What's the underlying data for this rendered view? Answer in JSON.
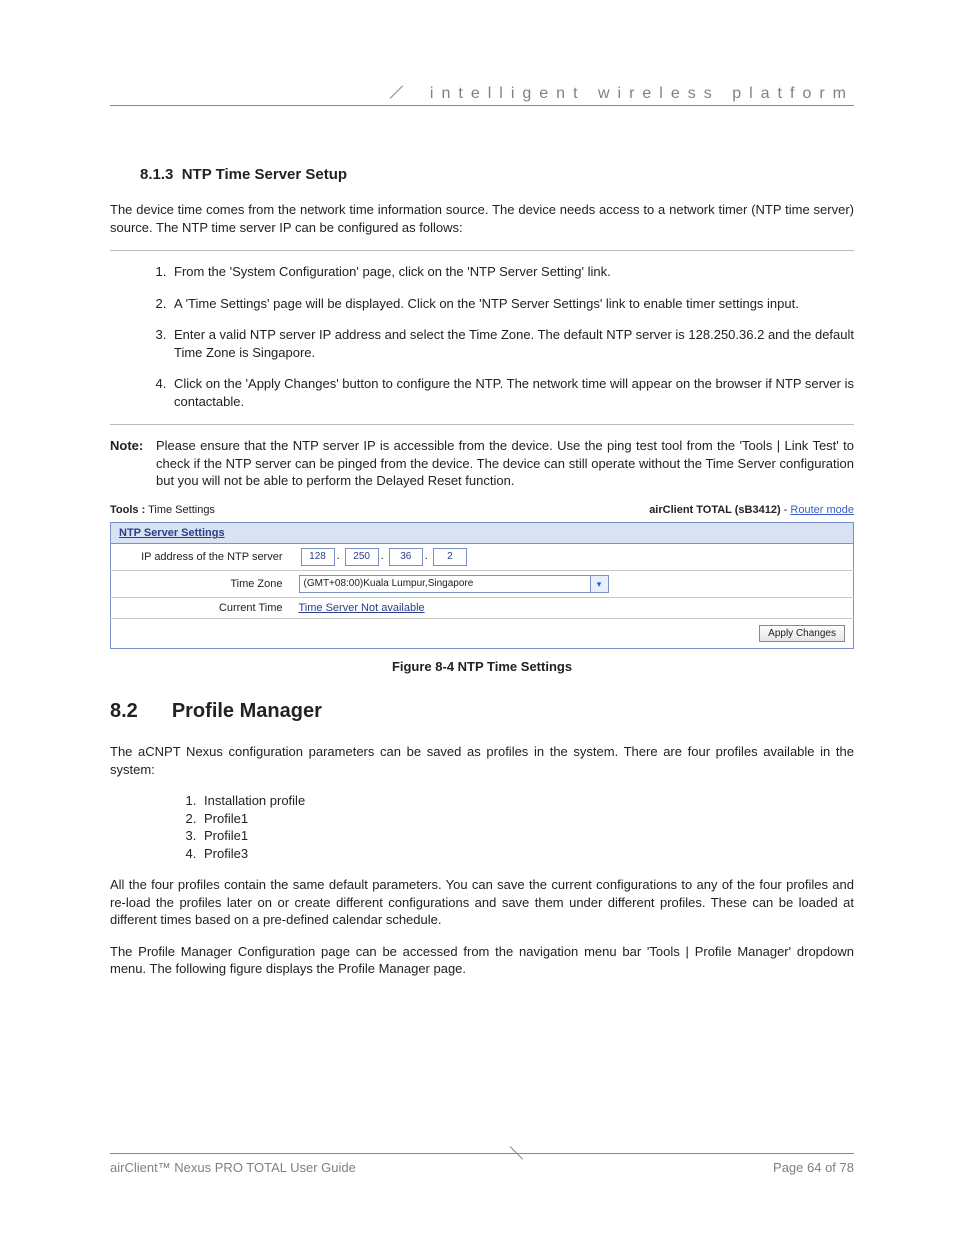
{
  "header": {
    "tagline": "intelligent wireless platform"
  },
  "section_813": {
    "number": "8.1.3",
    "title": "NTP Time Server Setup",
    "intro": "The device time comes from the network time information source. The device needs access to a network timer (NTP time server) source.  The NTP time server IP can be configured as follows:",
    "steps": [
      "From the 'System Configuration' page, click on the 'NTP Server Setting' link.",
      "A 'Time Settings' page will be displayed.  Click on the 'NTP Server Settings' link to enable timer settings input.",
      "Enter a valid NTP server IP address and select the Time Zone. The default NTP server is 128.250.36.2 and the default Time Zone is Singapore.",
      "Click on the 'Apply Changes' button to configure the NTP. The network time will appear on the browser if NTP server is contactable."
    ],
    "note_label": "Note:",
    "note_text": "Please ensure that the NTP server IP is accessible from the device. Use the ping test tool from the 'Tools | Link Test' to check if the NTP server can be pinged from the device.  The device can still operate without the Time Server configuration but you will not be able to perform the Delayed Reset function."
  },
  "widget": {
    "breadcrumb_label": "Tools :",
    "breadcrumb_value": "Time Settings",
    "device": "airClient TOTAL (sB3412)",
    "sep": " - ",
    "mode": "Router mode",
    "panel_title": "NTP Server Settings",
    "rows": {
      "ip_label": "IP address of the NTP server",
      "ip": [
        "128",
        "250",
        "36",
        "2"
      ],
      "tz_label": "Time Zone",
      "tz_value": "(GMT+08:00)Kuala Lumpur,Singapore",
      "ct_label": "Current Time",
      "ct_value": "Time Server Not available"
    },
    "apply_label": "Apply Changes",
    "caption": "Figure 8-4 NTP Time Settings"
  },
  "section_82": {
    "number": "8.2",
    "title": "Profile Manager",
    "para1": "The aCNPT Nexus configuration parameters can be saved as profiles in the system. There are four profiles available in the system:",
    "profiles": [
      "Installation profile",
      "Profile1",
      "Profile1",
      "Profile3"
    ],
    "para2": "All the four profiles contain the same default parameters. You can save the current configurations to any of the four profiles and re-load the profiles later on or create different configurations and save them under different profiles. These can be loaded at different times based on a pre-defined calendar schedule.",
    "para3": "The Profile Manager Configuration page can be accessed from the navigation menu bar 'Tools | Profile Manager' dropdown menu. The following figure displays the Profile Manager page."
  },
  "footer": {
    "left": "airClient™ Nexus PRO TOTAL User Guide",
    "right": "Page 64 of 78"
  }
}
